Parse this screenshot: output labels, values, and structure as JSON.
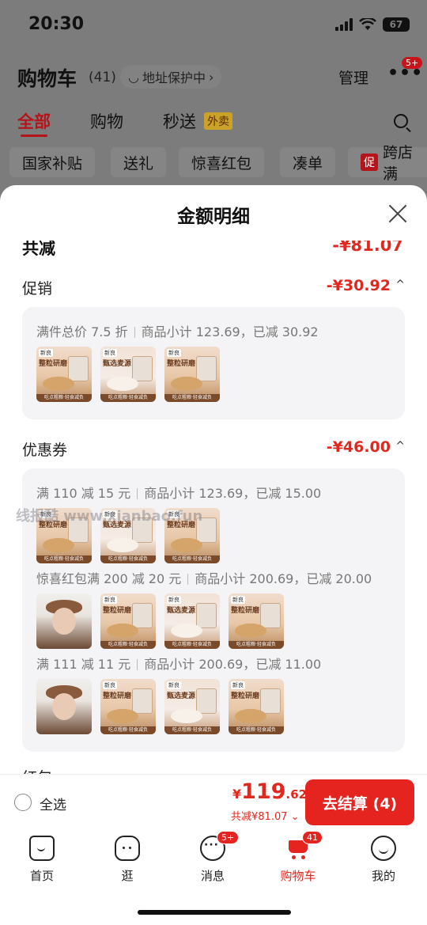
{
  "status_bar": {
    "time": "20:30",
    "battery": "67"
  },
  "header": {
    "title": "购物车",
    "count": "(41)",
    "address_pill": "地址保护中",
    "manage": "管理",
    "more_badge": "5+"
  },
  "top_tabs": [
    {
      "label": "全部"
    },
    {
      "label": "购物"
    },
    {
      "label": "秒送",
      "tag": "外卖"
    }
  ],
  "chips": [
    {
      "label": "国家补贴"
    },
    {
      "label": "送礼"
    },
    {
      "label": "惊喜红包"
    },
    {
      "label": "凑单"
    },
    {
      "label": "跨店满",
      "tag": "促"
    }
  ],
  "sheet": {
    "title": "金额明细",
    "total_label": "共减",
    "total_amount": "-¥81.07",
    "promo": {
      "label": "促销",
      "amount": "-¥30.92",
      "caret": "^",
      "line": {
        "rule": "满件总价 7.5 折",
        "detail": "商品小计 123.69，已减 30.92"
      }
    },
    "coupon": {
      "label": "优惠券",
      "amount": "-¥46.00",
      "caret": "^",
      "lines": [
        {
          "rule": "满 110 减 15 元",
          "detail": "商品小计 123.69，已减 15.00"
        },
        {
          "rule": "惊喜红包满 200 减 20 元",
          "detail": "商品小计 200.69，已减 20.00"
        },
        {
          "rule": "满 111 减 11 元",
          "detail": "商品小计 200.69，已减 11.00"
        }
      ]
    },
    "next_label": "红包",
    "watermark": "线报酷 www.xianbao.fun"
  },
  "thumb_text": {
    "brand": "新良",
    "name_a": "整粒研磨",
    "name_b": "甄选麦源",
    "name_c": "全麦粉",
    "foot": "吃点粗粮·轻食减负"
  },
  "checkout": {
    "select_all": "全选",
    "price_currency": "¥",
    "price_int": "119",
    "price_dec": ".62",
    "saved": "共减¥81.07",
    "button": "去结算 (4)"
  },
  "tabbar": [
    {
      "label": "首页",
      "icon": "home-icon"
    },
    {
      "label": "逛",
      "icon": "browse-icon"
    },
    {
      "label": "消息",
      "icon": "message-icon",
      "badge": "5+"
    },
    {
      "label": "购物车",
      "icon": "cart-icon",
      "badge": "41"
    },
    {
      "label": "我的",
      "icon": "profile-icon"
    }
  ],
  "colors": {
    "accent": "#e0281f",
    "button": "#e52420",
    "dim_bg": "#7c7c7c"
  }
}
